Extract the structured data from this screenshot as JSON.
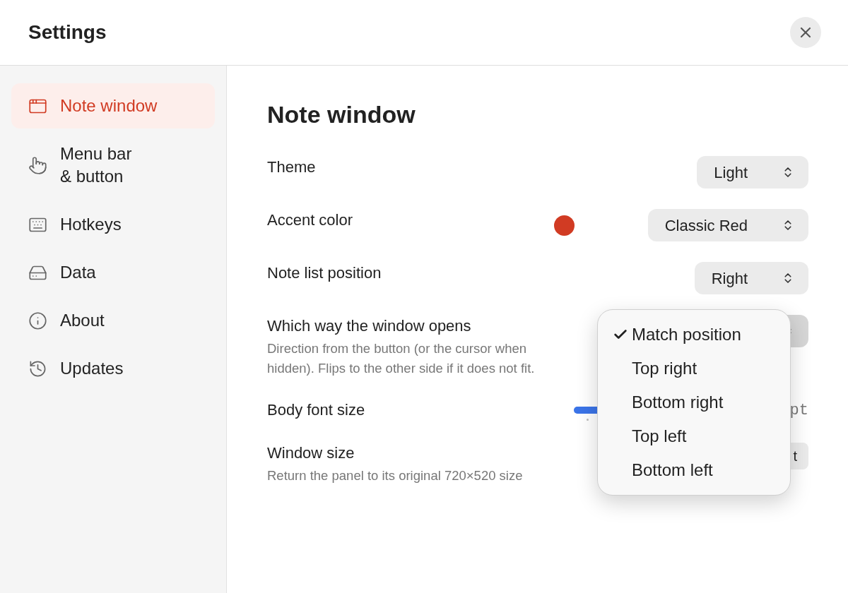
{
  "window": {
    "title": "Settings"
  },
  "sidebar": {
    "items": [
      {
        "label": "Note window",
        "selected": true
      },
      {
        "label": "Menu bar\n& button",
        "selected": false
      },
      {
        "label": "Hotkeys",
        "selected": false
      },
      {
        "label": "Data",
        "selected": false
      },
      {
        "label": "About",
        "selected": false
      },
      {
        "label": "Updates",
        "selected": false
      }
    ]
  },
  "page": {
    "title": "Note window",
    "rows": [
      {
        "kind": "select",
        "label": "Theme",
        "value": "Light",
        "expanded": false
      },
      {
        "kind": "color-select",
        "label": "Accent color",
        "color": "#d13b23",
        "value": "Classic Red",
        "expanded": false
      },
      {
        "kind": "select",
        "label": "Note list position",
        "value": "Right",
        "expanded": false
      },
      {
        "kind": "select",
        "label": "Which way the window opens",
        "description": "Direction from the button (or the cursor when hidden). Flips to the other side if it does not fit.",
        "expanded": true
      },
      {
        "kind": "slider",
        "label": "Body font size",
        "level": 0.24,
        "reading": "pt"
      },
      {
        "kind": "button",
        "label": "Window size",
        "description": "Return the panel to its original 720×520 size",
        "button": "t"
      }
    ]
  },
  "menu": {
    "items": [
      {
        "label": "Match position",
        "selected": true
      },
      {
        "label": "Top right",
        "selected": false
      },
      {
        "label": "Bottom right",
        "selected": false
      },
      {
        "label": "Top left",
        "selected": false
      },
      {
        "label": "Bottom left",
        "selected": false
      }
    ]
  }
}
